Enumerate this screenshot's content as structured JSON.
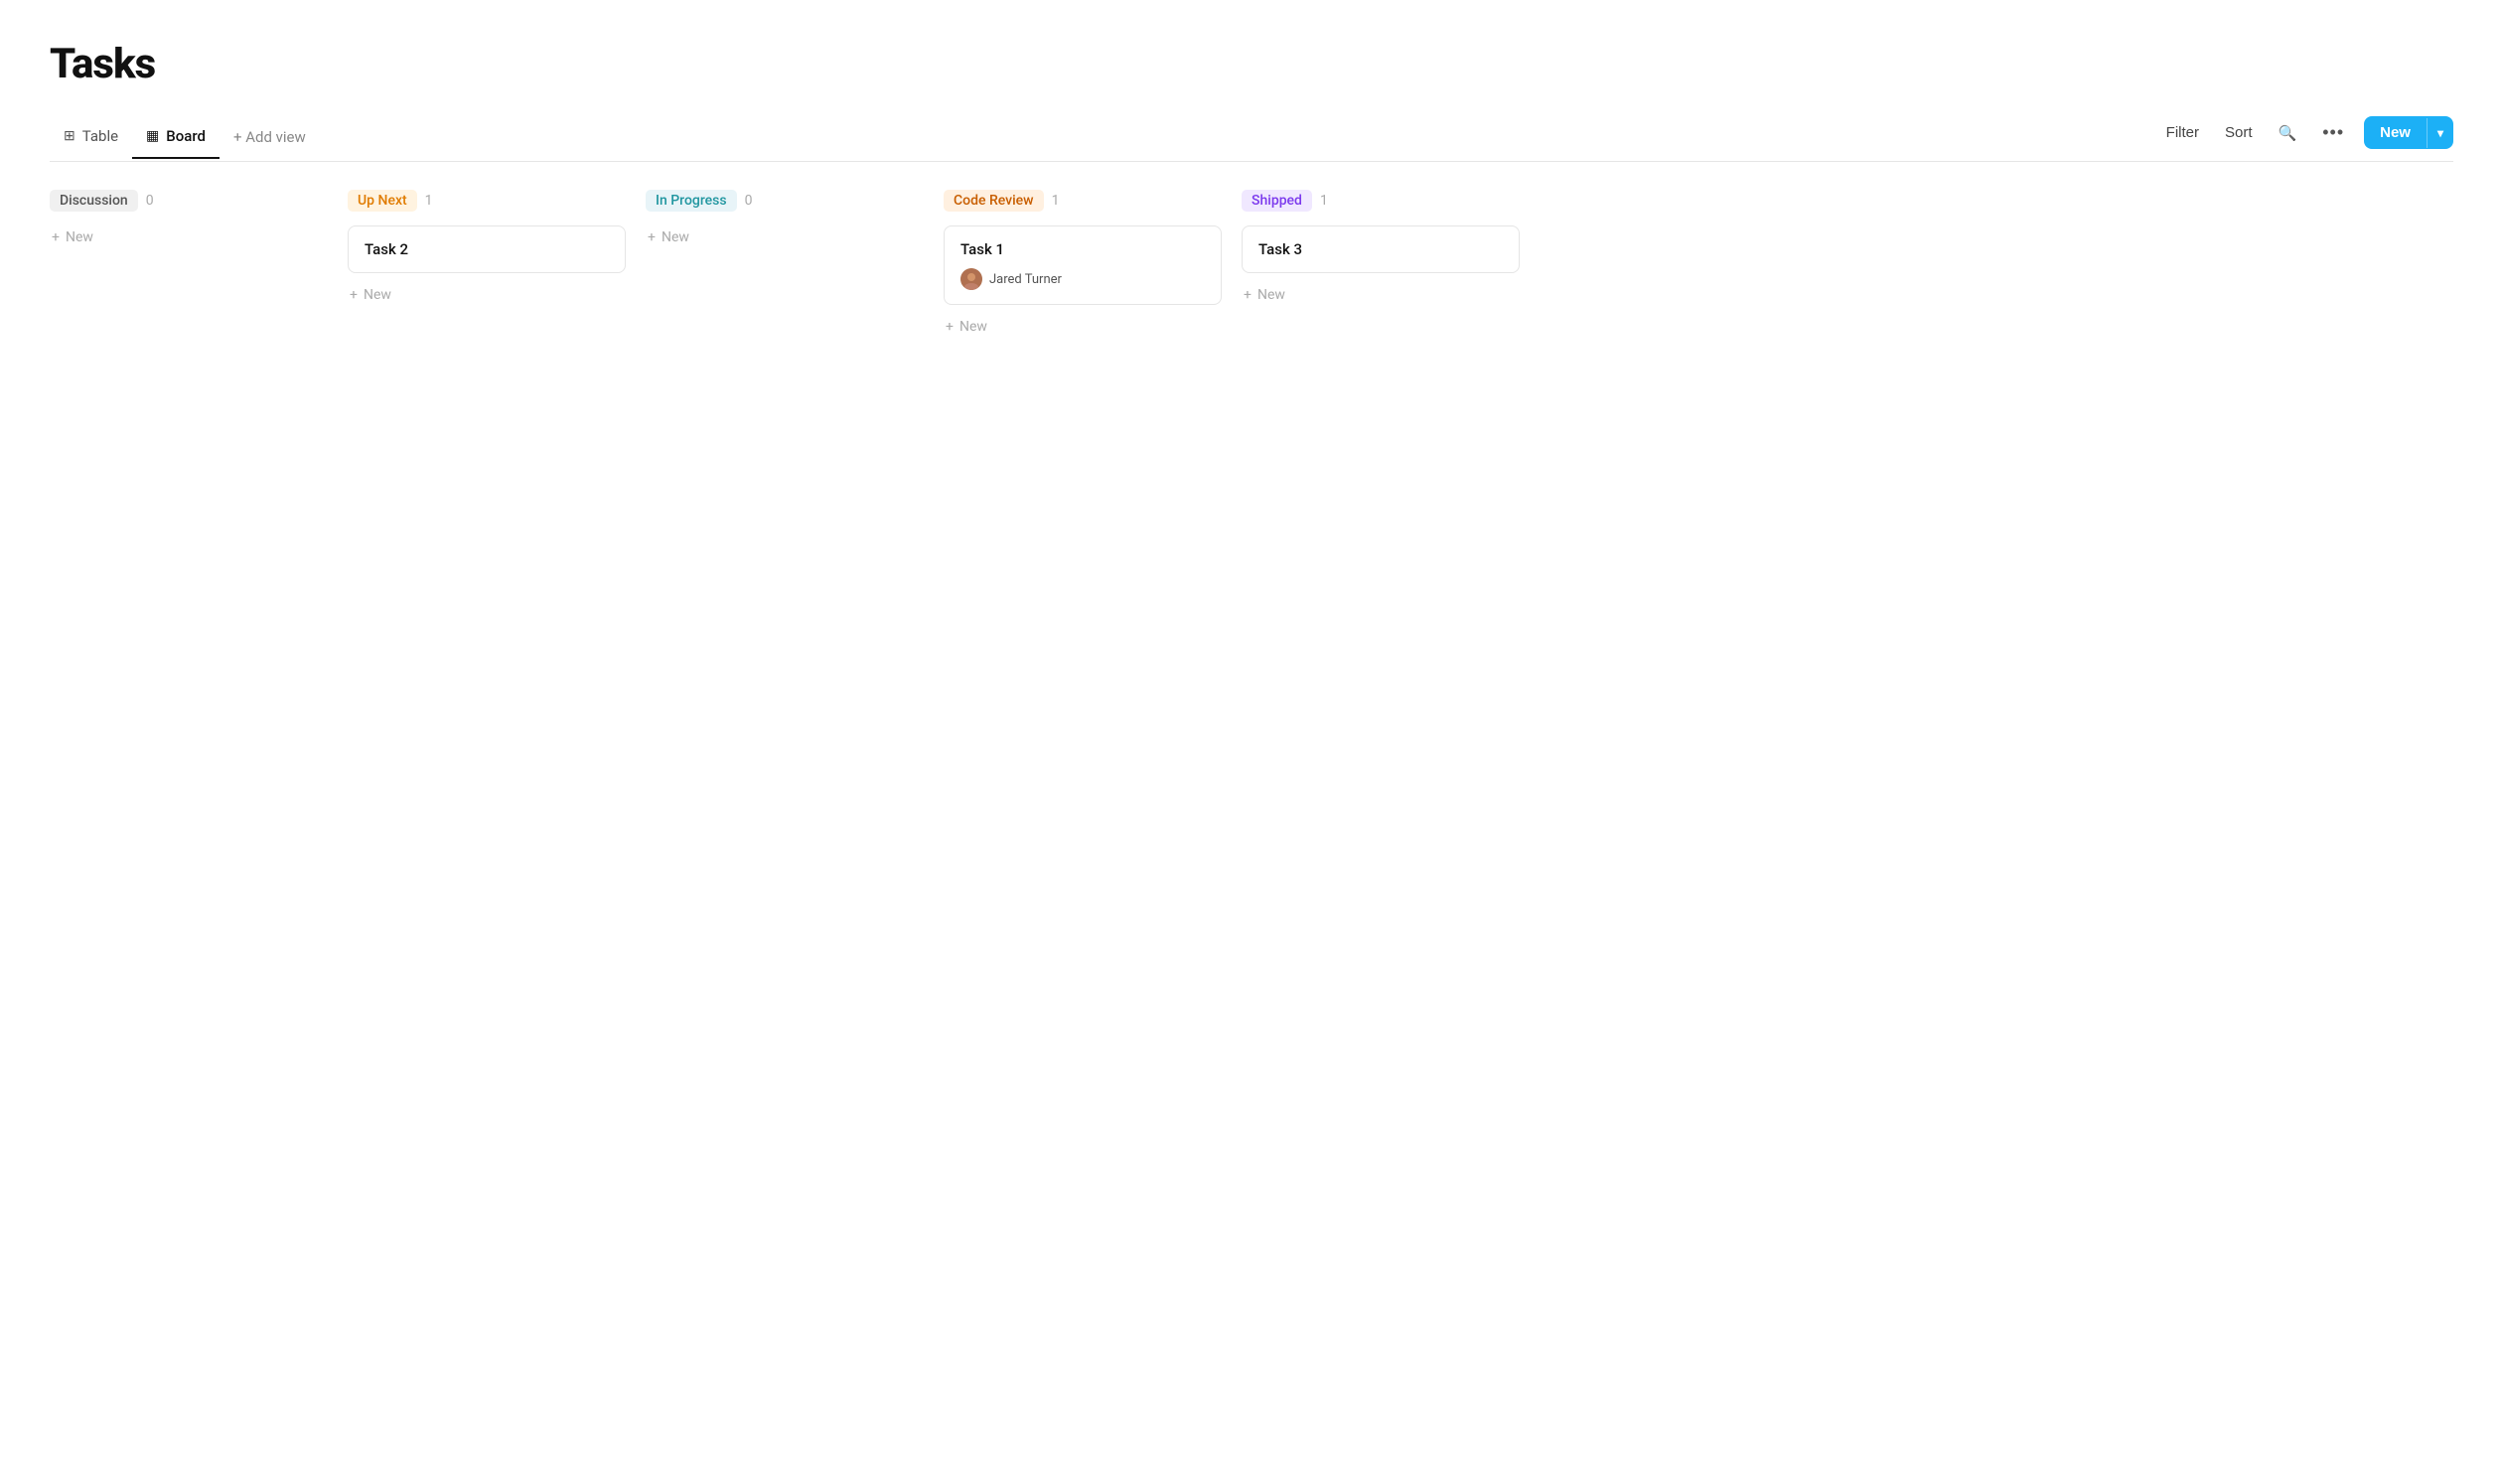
{
  "page": {
    "title": "Tasks"
  },
  "tabs": [
    {
      "id": "table",
      "label": "Table",
      "icon": "⊞",
      "active": false
    },
    {
      "id": "board",
      "label": "Board",
      "icon": "▦",
      "active": true
    }
  ],
  "add_view": "+ Add view",
  "toolbar": {
    "filter": "Filter",
    "sort": "Sort",
    "search_icon": "🔍",
    "more_icon": "•••",
    "new_label": "New",
    "chevron": "▾"
  },
  "columns": [
    {
      "id": "discussion",
      "label": "Discussion",
      "label_class": "label-discussion",
      "count": 0,
      "cards": [],
      "add_label": "+ New"
    },
    {
      "id": "upnext",
      "label": "Up Next",
      "label_class": "label-upnext",
      "count": 1,
      "cards": [
        {
          "id": "task2",
          "title": "Task 2",
          "assignee": null
        }
      ],
      "add_label": "+ New"
    },
    {
      "id": "inprogress",
      "label": "In Progress",
      "label_class": "label-inprogress",
      "count": 0,
      "cards": [],
      "add_label": "+ New"
    },
    {
      "id": "codereview",
      "label": "Code Review",
      "label_class": "label-codereview",
      "count": 1,
      "cards": [
        {
          "id": "task1",
          "title": "Task 1",
          "assignee": "Jared Turner"
        }
      ],
      "add_label": "+ New"
    },
    {
      "id": "shipped",
      "label": "Shipped",
      "label_class": "label-shipped",
      "count": 1,
      "cards": [
        {
          "id": "task3",
          "title": "Task 3",
          "assignee": null
        }
      ],
      "add_label": "+ New"
    }
  ]
}
